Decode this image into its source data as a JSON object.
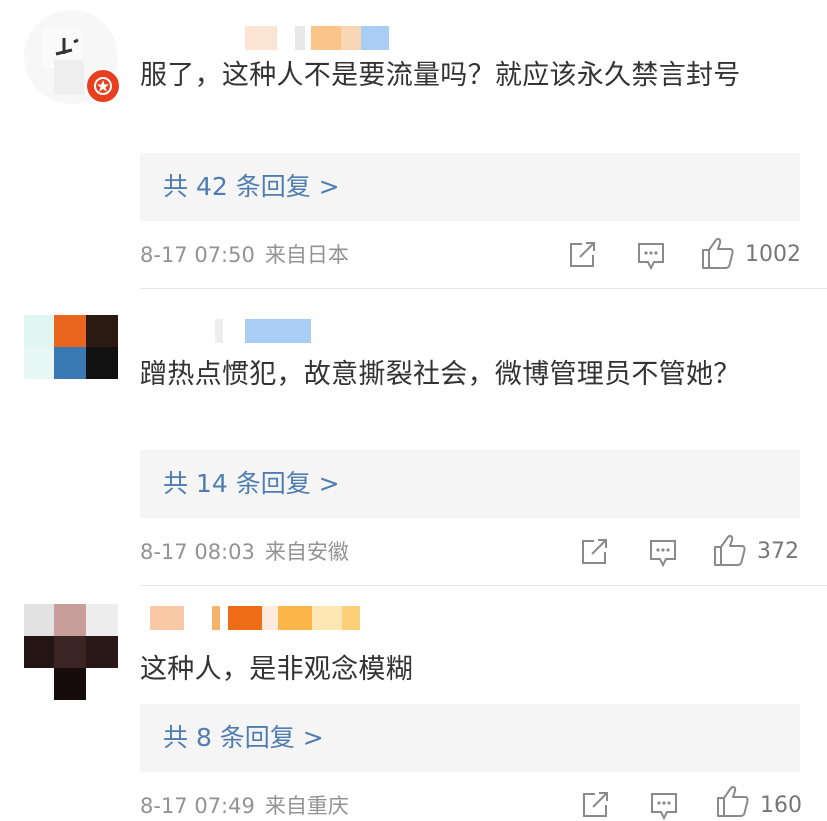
{
  "comments": [
    {
      "text": "服了，这种人不是要流量吗？就应该永久禁言封号",
      "replies": "共 42 条回复 >",
      "time": "8-17 07:50",
      "location": "来自日本",
      "likes": "1002"
    },
    {
      "text": "蹭热点惯犯，故意撕裂社会，微博管理员不管她？",
      "replies": "共 14 条回复 >",
      "time": "8-17 08:03",
      "location": "来自安徽",
      "likes": "372"
    },
    {
      "text": "这种人，是非观念模糊",
      "replies": "共 8 条回复 >",
      "time": "8-17 07:49",
      "location": "来自重庆",
      "likes": "160"
    }
  ],
  "colors": {
    "reply_link": "#507daf",
    "meta_text": "#939393",
    "reply_bg": "#f5f5f5",
    "badge": "#e8401f"
  },
  "icons": {
    "share": "share-icon",
    "comment": "comment-icon",
    "like": "thumbs-up-icon",
    "badge": "verified-badge-icon"
  }
}
